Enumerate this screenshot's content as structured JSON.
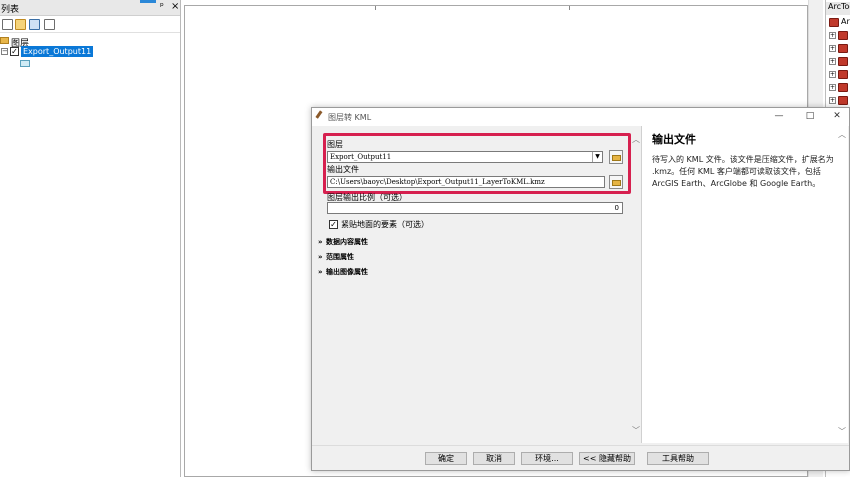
{
  "toc": {
    "title": "列表",
    "pin": "ᵖ",
    "close": "×",
    "group_label": "图层",
    "layer_name": "Export_Output11",
    "checked": "✓",
    "expander": "−"
  },
  "toolbox": {
    "title": "ArcToolbox",
    "root_label": "Arc",
    "expander": "+"
  },
  "dialog": {
    "title": "图层转 KML",
    "win_min": "—",
    "win_max": "□",
    "win_close": "✕",
    "fields": {
      "layer_label": "图层",
      "layer_value": "Export_Output11",
      "output_label": "输出文件",
      "output_value": "C:\\Users\\baoyc\\Desktop\\Export_Output11_LayerToKML.kmz",
      "scale_label": "图层输出比例（可选）",
      "scale_value": "0",
      "clamp_label": "紧贴地面的要素（可选）",
      "clamp_checked": "✓"
    },
    "sections": [
      {
        "label": "数据内容属性"
      },
      {
        "label": "范围属性"
      },
      {
        "label": "输出图像属性"
      }
    ],
    "help": {
      "title": "输出文件",
      "body": "待写入的 KML 文件。该文件是压缩文件，扩展名为 .kmz。任何 KML 客户端都可读取该文件，包括 ArcGIS Earth、ArcGlobe 和 Google Earth。"
    },
    "buttons": {
      "ok": "确定",
      "cancel": "取消",
      "env": "环境...",
      "hide_help": "<< 隐藏帮助",
      "tool_help": "工具帮助"
    },
    "highlight_color": "#d6204f"
  }
}
